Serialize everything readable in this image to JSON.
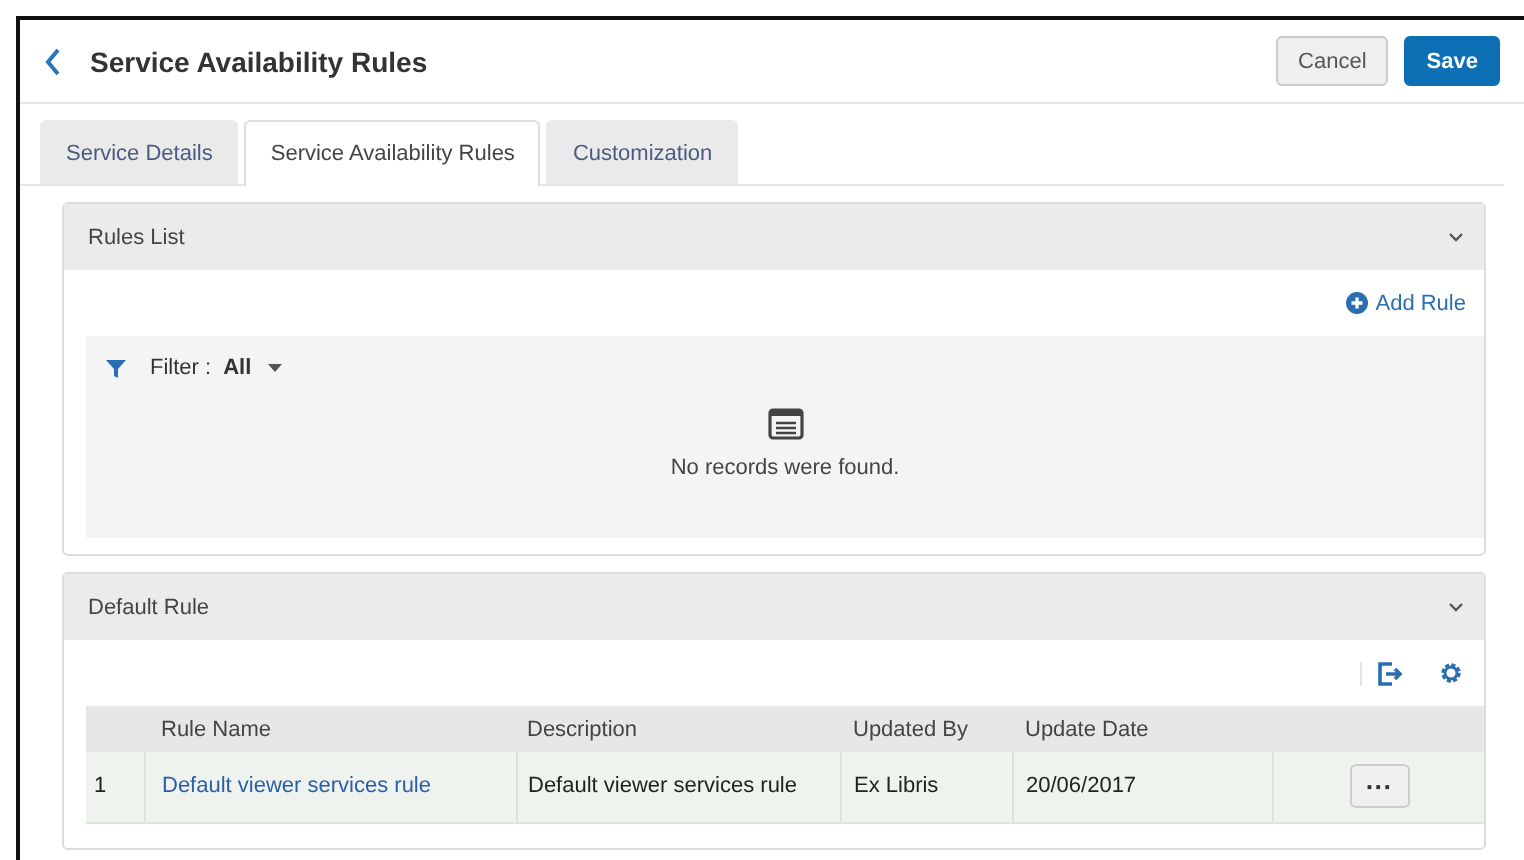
{
  "header": {
    "title": "Service Availability Rules",
    "buttons": [
      {
        "label": "Cancel",
        "kind": "secondary"
      },
      {
        "label": "Save",
        "kind": "primary"
      }
    ]
  },
  "tabs": [
    {
      "label": "Service Details",
      "selected": false
    },
    {
      "label": "Service Availability Rules",
      "selected": true
    },
    {
      "label": "Customization",
      "selected": false
    }
  ],
  "rules_list": {
    "title": "Rules List",
    "add_label": "Add Rule",
    "filter_label": "Filter :",
    "filter_value": "All",
    "empty_message": "No records were found."
  },
  "default_rule": {
    "title": "Default Rule",
    "table": {
      "columns": [
        "Rule Name",
        "Description",
        "Updated By",
        "Update Date"
      ],
      "rows": [
        {
          "index": "1",
          "cells": [
            "Default viewer services rule",
            "Default viewer services rule",
            "Ex Libris",
            "20/06/2017"
          ],
          "actions": "···"
        }
      ]
    }
  }
}
